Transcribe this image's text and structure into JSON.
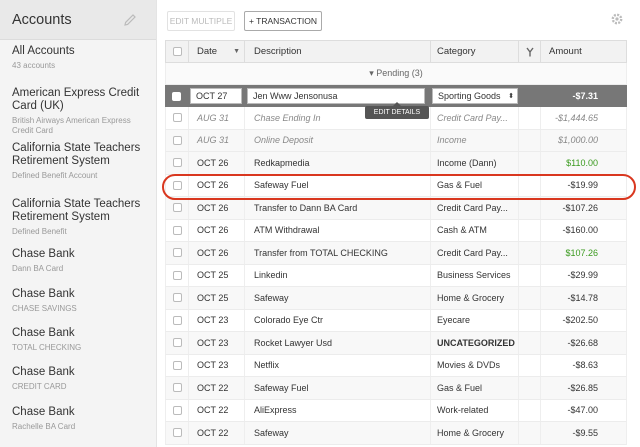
{
  "sidebar": {
    "title": "Accounts",
    "accounts": [
      {
        "name": "All Accounts",
        "sub": "43 accounts"
      },
      {
        "name": "American Express Credit Card (UK)",
        "sub": "British Airways American Express Credit Card"
      },
      {
        "name": "California State Teachers Retirement System",
        "sub": "Defined Benefit Account"
      },
      {
        "name": "California State Teachers Retirement System",
        "sub": "Defined Benefit"
      },
      {
        "name": "Chase Bank",
        "sub": "Dann BA Card"
      },
      {
        "name": "Chase Bank",
        "sub": "CHASE SAVINGS"
      },
      {
        "name": "Chase Bank",
        "sub": "TOTAL CHECKING"
      },
      {
        "name": "Chase Bank",
        "sub": "CREDIT CARD"
      },
      {
        "name": "Chase Bank",
        "sub": "Rachelle BA Card"
      }
    ]
  },
  "toolbar": {
    "edit_multiple": "EDIT MULTIPLE",
    "add_transaction": "+ TRANSACTION"
  },
  "table": {
    "headers": {
      "date": "Date",
      "description": "Description",
      "category": "Category",
      "amount": "Amount"
    },
    "pending_label": "▾ Pending (3)",
    "editing": {
      "date": "OCT 27",
      "description": "Jen Www Jensonusa",
      "category": "Sporting Goods",
      "amount": "-$7.31",
      "tooltip": "EDIT DETAILS"
    },
    "pending": [
      {
        "date": "AUG 31",
        "description": "Chase Ending In",
        "category": "Credit Card Pay...",
        "amount": "-$1,444.65"
      },
      {
        "date": "AUG 31",
        "description": "Online Deposit",
        "category": "Income",
        "amount": "$1,000.00"
      }
    ],
    "rows": [
      {
        "date": "OCT 26",
        "description": "Redkapmedia",
        "category": "Income (Dann)",
        "amount": "$110.00",
        "positive": true
      },
      {
        "date": "OCT 26",
        "description": "Safeway Fuel",
        "category": "Gas & Fuel",
        "amount": "-$19.99"
      },
      {
        "date": "OCT 26",
        "description": "Transfer to Dann BA Card",
        "category": "Credit Card Pay...",
        "amount": "-$107.26"
      },
      {
        "date": "OCT 26",
        "description": "ATM Withdrawal",
        "category": "Cash & ATM",
        "amount": "-$160.00"
      },
      {
        "date": "OCT 26",
        "description": "Transfer from TOTAL CHECKING",
        "category": "Credit Card Pay...",
        "amount": "$107.26",
        "positive": true
      },
      {
        "date": "OCT 25",
        "description": "Linkedin",
        "category": "Business Services",
        "amount": "-$29.99"
      },
      {
        "date": "OCT 25",
        "description": "Safeway",
        "category": "Home & Grocery",
        "amount": "-$14.78"
      },
      {
        "date": "OCT 23",
        "description": "Colorado Eye Ctr",
        "category": "Eyecare",
        "amount": "-$202.50"
      },
      {
        "date": "OCT 23",
        "description": "Rocket Lawyer Usd",
        "category": "UNCATEGORIZED",
        "amount": "-$26.68",
        "bold_cat": true
      },
      {
        "date": "OCT 23",
        "description": "Netflix",
        "category": "Movies & DVDs",
        "amount": "-$8.63"
      },
      {
        "date": "OCT 22",
        "description": "Safeway Fuel",
        "category": "Gas & Fuel",
        "amount": "-$26.85"
      },
      {
        "date": "OCT 22",
        "description": "AliExpress",
        "category": "Work-related",
        "amount": "-$47.00"
      },
      {
        "date": "OCT 22",
        "description": "Safeway",
        "category": "Home & Grocery",
        "amount": "-$9.55"
      }
    ]
  },
  "colors": {
    "highlight": "#d9371f",
    "positive": "#3a9a1e"
  }
}
